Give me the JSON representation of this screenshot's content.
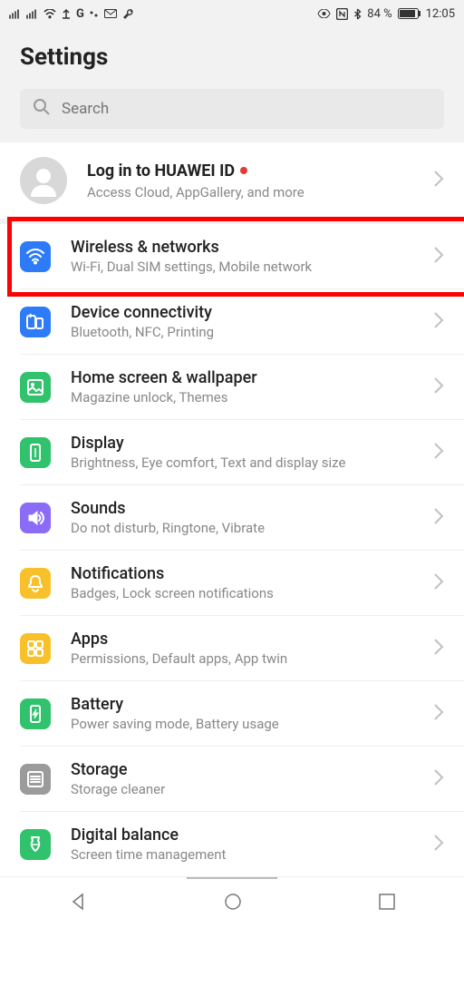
{
  "status": {
    "battery_pct": "84 %",
    "time": "12:05"
  },
  "header": {
    "title": "Settings"
  },
  "search": {
    "placeholder": "Search"
  },
  "account": {
    "title": "Log in to HUAWEI ID",
    "subtitle": "Access Cloud, AppGallery, and more"
  },
  "items": [
    {
      "title": "Wireless & networks",
      "subtitle": "Wi-Fi, Dual SIM settings, Mobile network",
      "color": "#2d7bf6"
    },
    {
      "title": "Device connectivity",
      "subtitle": "Bluetooth, NFC, Printing",
      "color": "#2d7bf6"
    },
    {
      "title": "Home screen & wallpaper",
      "subtitle": "Magazine unlock, Themes",
      "color": "#31c26e"
    },
    {
      "title": "Display",
      "subtitle": "Brightness, Eye comfort, Text and display size",
      "color": "#31c26e"
    },
    {
      "title": "Sounds",
      "subtitle": "Do not disturb, Ringtone, Vibrate",
      "color": "#8a6cf7"
    },
    {
      "title": "Notifications",
      "subtitle": "Badges, Lock screen notifications",
      "color": "#f8c12c"
    },
    {
      "title": "Apps",
      "subtitle": "Permissions, Default apps, App twin",
      "color": "#f8c12c"
    },
    {
      "title": "Battery",
      "subtitle": "Power saving mode, Battery usage",
      "color": "#31c26e"
    },
    {
      "title": "Storage",
      "subtitle": "Storage cleaner",
      "color": "#9b9b9b"
    },
    {
      "title": "Digital balance",
      "subtitle": "Screen time management",
      "color": "#31c26e"
    }
  ],
  "highlight_index": 0
}
